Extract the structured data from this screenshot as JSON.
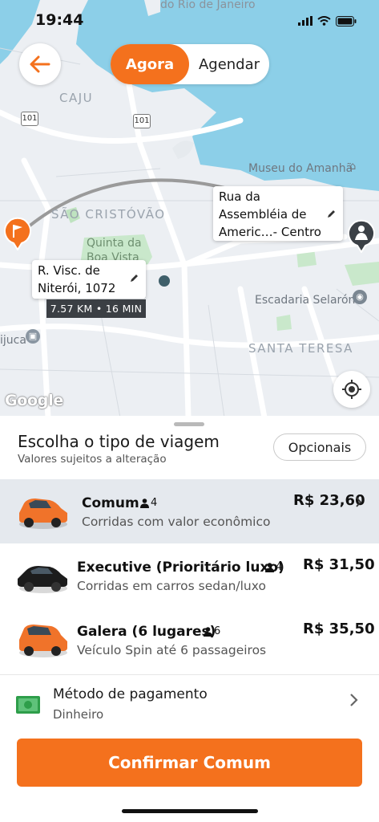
{
  "status_bar": {
    "time": "19:44"
  },
  "header": {
    "mode_now": "Agora",
    "mode_schedule": "Agendar"
  },
  "map": {
    "labels": {
      "rio": "do Rio de Janeiro",
      "caju": "CAJU",
      "sao_cristovao": "SÃO CRISTÓVÃO",
      "quinta_1": "Quinta da",
      "quinta_2": "Boa Vista",
      "museu": "Museu do Amanhã",
      "escadaria": "Escadaria Selarón",
      "santa_teresa": "SANTA TERESA",
      "tijuca": "ijuca",
      "route_101_a": "101",
      "route_101_b": "101"
    },
    "origin": {
      "line1": "R. Visc. de",
      "line2": "Niterói, 1072"
    },
    "destination": {
      "line1": "Rua da",
      "line2": "Assembléia de",
      "line3": "Americ…- Centro"
    },
    "trip_info": "7.57 KM • 16 MIN",
    "attribution": "Google"
  },
  "sheet": {
    "title": "Escolha o tipo de viagem",
    "subtitle": "Valores sujeitos a alteração",
    "options_label": "Opcionais",
    "rides": [
      {
        "name": "Comum",
        "pax": "4",
        "desc": "Corridas com valor econômico",
        "price": "R$ 23,60",
        "car_color": "#f0732a"
      },
      {
        "name": "Executive (Prioritário luxo)",
        "pax": "4",
        "desc": "Corridas em carros sedan/luxo",
        "price": "R$ 31,50",
        "car_color": "#1c1c1c"
      },
      {
        "name": "Galera (6 lugares)",
        "pax": "6",
        "desc": "Veículo Spin até 6 passageiros",
        "price": "R$ 35,50",
        "car_color": "#f0732a"
      }
    ],
    "payment": {
      "title": "Método de pagamento",
      "value": "Dinheiro"
    },
    "confirm_label": "Confirmar Comum"
  },
  "colors": {
    "accent": "#f4711d",
    "water": "#8ccfe8",
    "selected_row": "#e5e9ee"
  }
}
